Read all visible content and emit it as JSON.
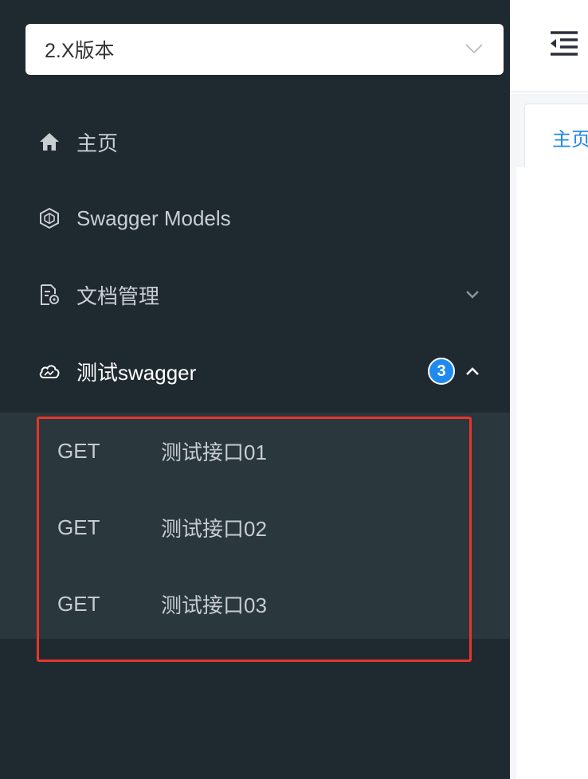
{
  "sidebar": {
    "version_select": {
      "value": "2.X版本",
      "icon": "chevron-down-icon"
    },
    "menu": [
      {
        "label": "主页",
        "icon": "home-icon"
      },
      {
        "label": "Swagger Models",
        "icon": "models-icon"
      },
      {
        "label": "文档管理",
        "icon": "document-settings-icon",
        "expand_icon": "chevron-down-icon"
      },
      {
        "label": "测试swagger",
        "icon": "cloud-icon",
        "badge": "3",
        "expand_icon": "chevron-up-icon",
        "expanded": true
      }
    ],
    "submenu": [
      {
        "method": "GET",
        "name": "测试接口01"
      },
      {
        "method": "GET",
        "name": "测试接口02"
      },
      {
        "method": "GET",
        "name": "测试接口03"
      }
    ]
  },
  "main": {
    "tabs": [
      {
        "label": "主页"
      }
    ]
  },
  "colors": {
    "sidebar_bg": "#1f2a30",
    "submenu_bg": "#2a373d",
    "badge": "#1e8af0",
    "highlight": "#e8352c",
    "tab_text": "#1e88e5"
  }
}
